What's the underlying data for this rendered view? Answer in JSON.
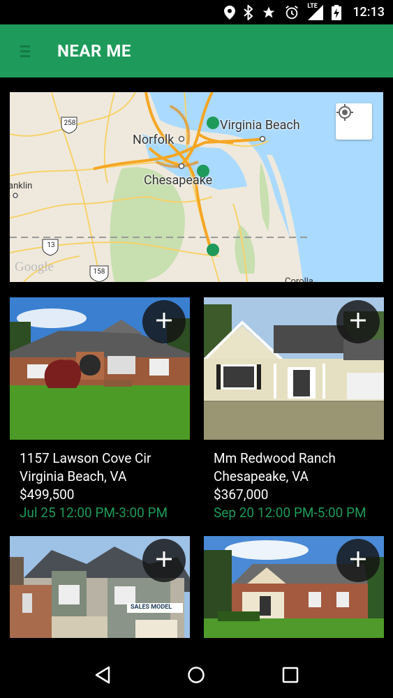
{
  "status_bar": {
    "time": "12:13",
    "icons": [
      "location-icon",
      "bluetooth-icon",
      "star-icon",
      "alarm-icon",
      "lte-signal-icon",
      "battery-charging-icon"
    ],
    "network": "LTE"
  },
  "app_bar": {
    "title": "NEAR ME",
    "menu_icon": "hamburger-menu-icon"
  },
  "map": {
    "labels": {
      "city1": "Norfolk",
      "city2": "Virginia Beach",
      "city3": "Chesapeake",
      "city4": "anklin",
      "city5": "Corolla",
      "route1": "258",
      "route2": "13",
      "route3": "158",
      "brand": "Google"
    },
    "marker_color": "#1e9a5a",
    "locate_icon": "my-location-icon"
  },
  "listings": [
    {
      "address": "1157 Lawson Cove Cir",
      "city": "Virginia Beach, VA",
      "price": "$499,500",
      "open_house": "Jul 25 12:00 PM-3:00 PM"
    },
    {
      "address": "Mm Redwood Ranch",
      "city": "Chesapeake, VA",
      "price": "$367,000",
      "open_house": "Sep 20 12:00 PM-5:00 PM"
    },
    {
      "address": "",
      "city": "",
      "price": "",
      "open_house": "",
      "sign": "SALES MODEL"
    },
    {
      "address": "",
      "city": "",
      "price": "",
      "open_house": ""
    }
  ],
  "colors": {
    "accent": "#1e9a5a",
    "background": "#000000"
  },
  "nav_bar": {
    "icons": [
      "back-icon",
      "home-icon",
      "recents-icon"
    ]
  }
}
